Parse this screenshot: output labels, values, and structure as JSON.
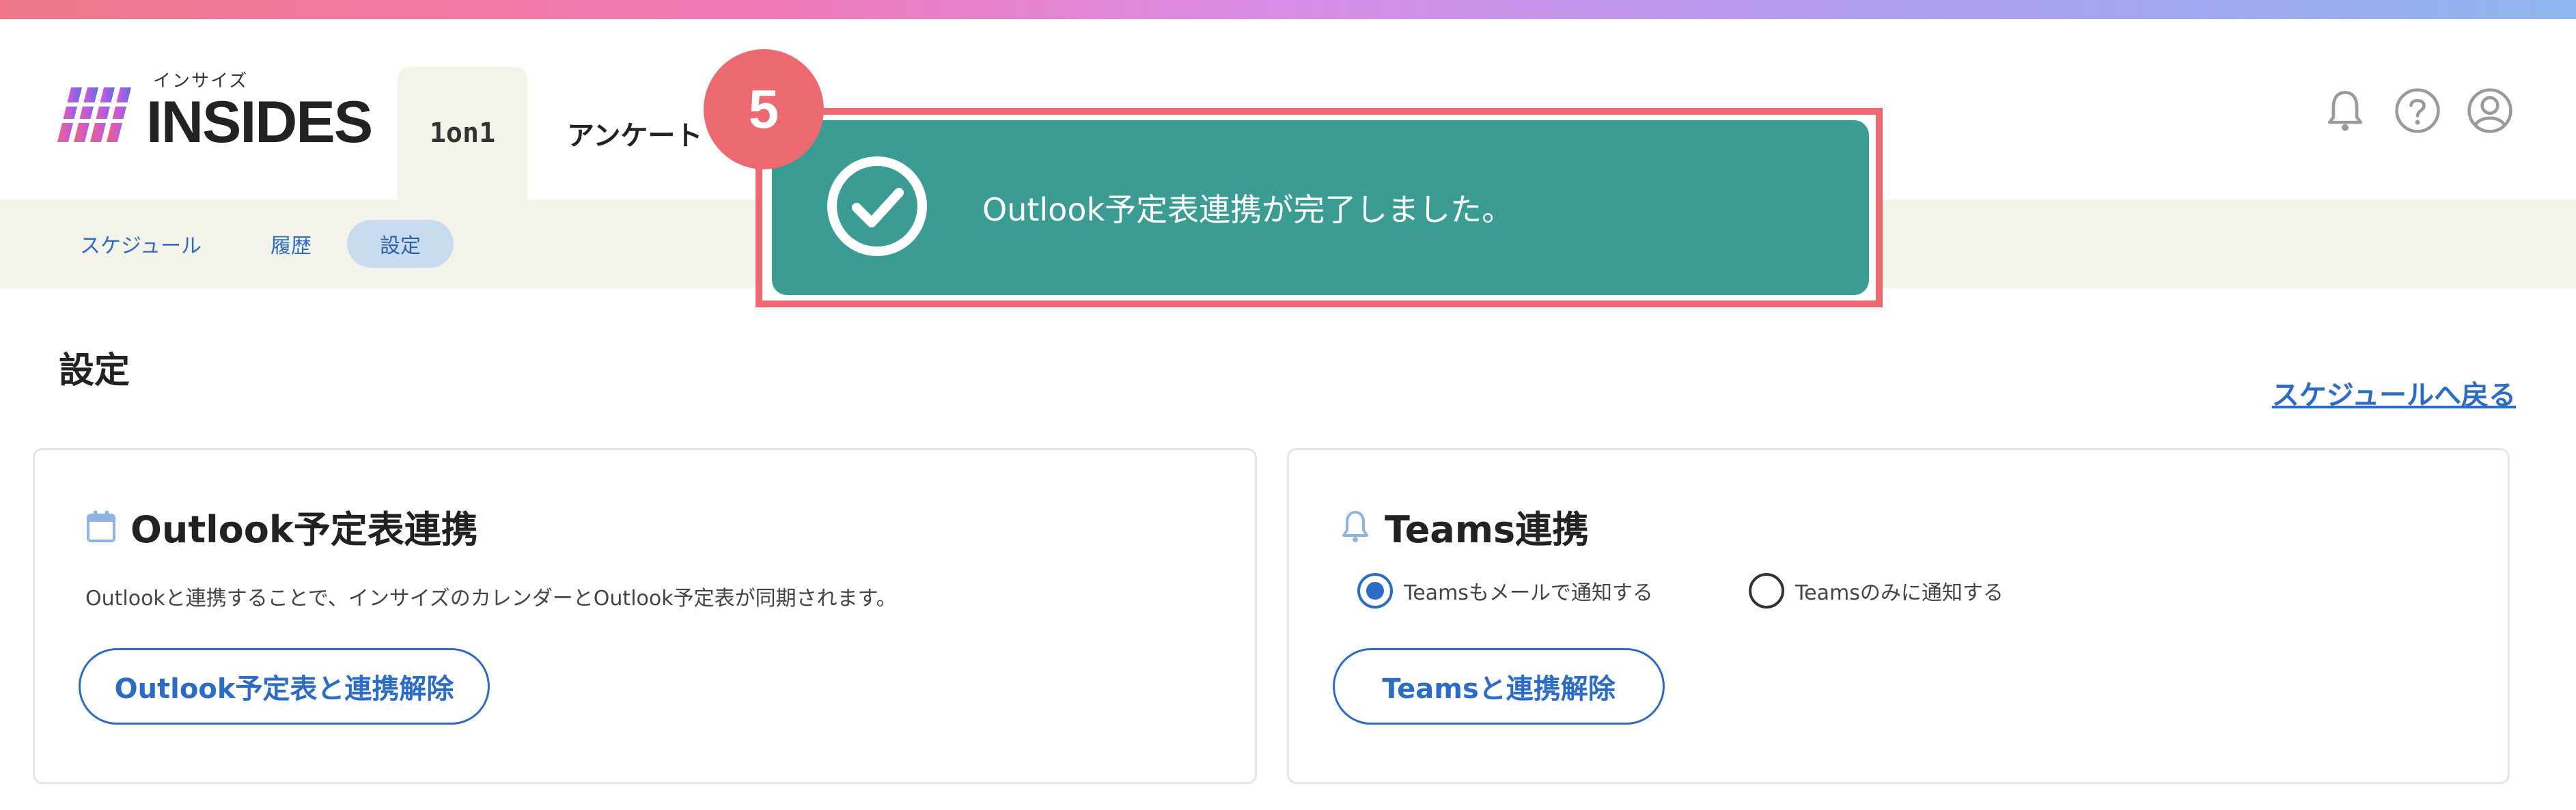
{
  "header": {
    "logo_small": "インサイズ",
    "logo_text": "INSIDES",
    "tabs": [
      {
        "label": "1on1",
        "active": true
      },
      {
        "label": "アンケート",
        "active": false
      }
    ],
    "icons": [
      "bell-icon",
      "help-icon",
      "user-icon"
    ]
  },
  "subnav": {
    "items": [
      {
        "label": "スケジュール",
        "active": false
      },
      {
        "label": "履歴",
        "active": false
      },
      {
        "label": "設定",
        "active": true
      }
    ]
  },
  "page": {
    "title": "設定",
    "back_link": "スケジュールへ戻る"
  },
  "outlook_card": {
    "icon": "calendar-icon",
    "title": "Outlook予定表連携",
    "description": "Outlookと連携することで、インサイズのカレンダーとOutlook予定表が同期されます。",
    "button": "Outlook予定表と連携解除"
  },
  "teams_card": {
    "icon": "bell-icon",
    "title": "Teams連携",
    "radio_options": [
      {
        "label": "Teamsもメールで通知する",
        "checked": true
      },
      {
        "label": "Teamsのみに通知する",
        "checked": false
      }
    ],
    "button": "Teamsと連携解除"
  },
  "toast": {
    "message": "Outlook予定表連携が完了しました。",
    "icon": "check-circle-icon",
    "color": "#3a9c92"
  },
  "annotation": {
    "step_number": "5",
    "color": "#ec6a6f"
  }
}
